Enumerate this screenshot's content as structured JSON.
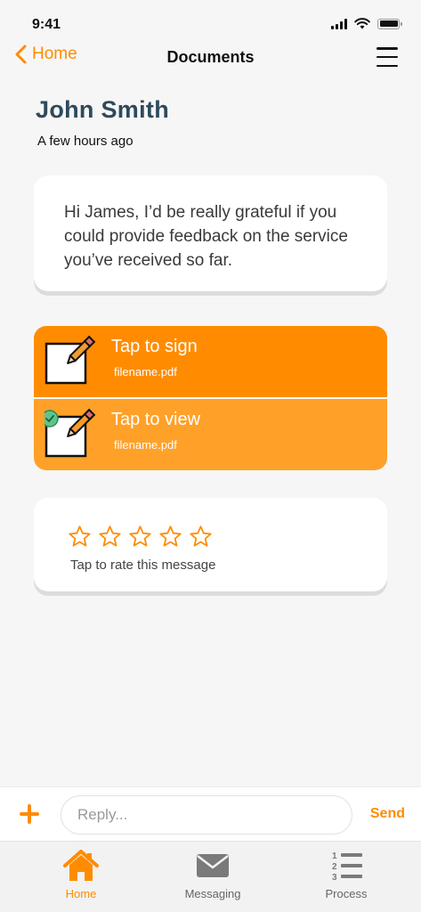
{
  "status_bar": {
    "time": "9:41"
  },
  "nav": {
    "back_label": "Home",
    "title": "Documents"
  },
  "header": {
    "name": "John Smith",
    "time": "A few hours ago"
  },
  "message": {
    "text": "Hi James, I’d be really grateful if you could provide feedback on the service you’ve received so far."
  },
  "documents": [
    {
      "title": "Tap to sign",
      "file": "filename.pdf",
      "signed": false
    },
    {
      "title": "Tap to view",
      "file": "filename.pdf",
      "signed": true
    }
  ],
  "rating": {
    "stars_total": 5,
    "stars_filled": 0,
    "label": "Tap to rate this message"
  },
  "reply": {
    "placeholder": "Reply...",
    "value": "",
    "send_label": "Send"
  },
  "tabs": [
    {
      "label": "Home",
      "icon": "home-icon",
      "active": true
    },
    {
      "label": "Messaging",
      "icon": "envelope-icon",
      "active": false
    },
    {
      "label": "Process",
      "icon": "numbered-list-icon",
      "active": false
    }
  ],
  "colors": {
    "accent": "#ff8c00",
    "accent_light": "#ffa128",
    "name": "#2e4a5c",
    "background": "#f6f6f6"
  }
}
